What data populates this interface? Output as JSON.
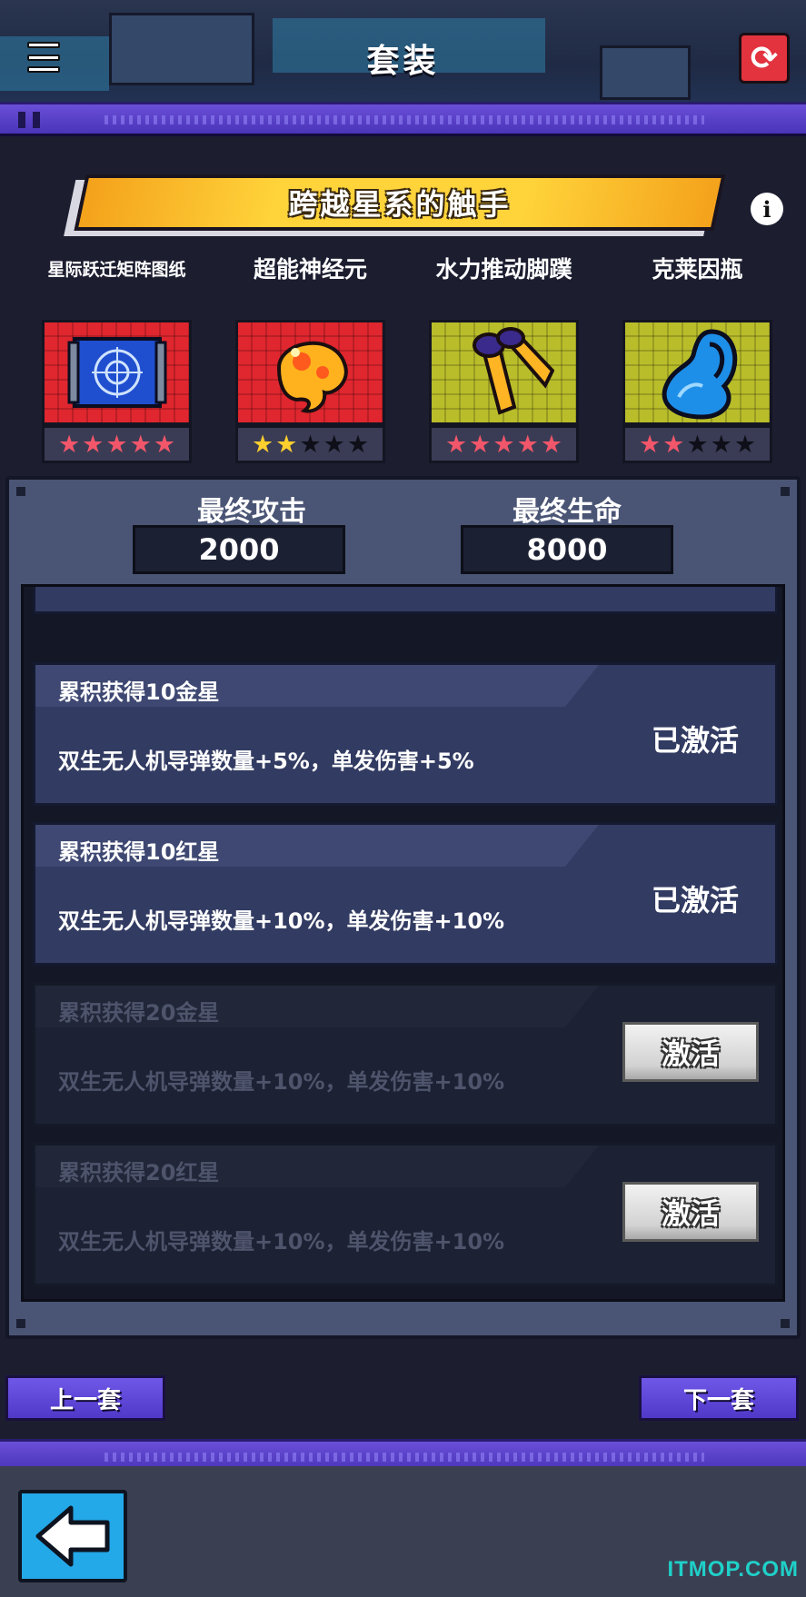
{
  "header": {
    "title": "套装",
    "menu_icon": "list-icon",
    "refresh_icon": "refresh-icon"
  },
  "set": {
    "name": "跨越星系的触手",
    "info_icon": "info-icon"
  },
  "items": [
    {
      "name": "星际跃迁矩阵图纸",
      "bg": "red",
      "rarity": "red",
      "stars_filled": 5,
      "stars_total": 5,
      "icon": "blueprint-icon"
    },
    {
      "name": "超能神经元",
      "bg": "red",
      "rarity": "gold",
      "stars_filled": 2,
      "stars_total": 5,
      "icon": "neuron-blob-icon"
    },
    {
      "name": "水力推动脚蹼",
      "bg": "yellow",
      "rarity": "red",
      "stars_filled": 5,
      "stars_total": 5,
      "icon": "flippers-icon"
    },
    {
      "name": "克莱因瓶",
      "bg": "yellow",
      "rarity": "red",
      "stars_filled": 2,
      "stars_total": 5,
      "icon": "klein-bottle-icon"
    }
  ],
  "stats": {
    "attack_label": "最终攻击",
    "attack_value": "2000",
    "life_label": "最终生命",
    "life_value": "8000"
  },
  "bonuses": [
    {
      "title": "累积获得10金星",
      "desc": "双生无人机导弹数量+5%，单发伤害+5%",
      "status": "已激活",
      "active": true
    },
    {
      "title": "累积获得10红星",
      "desc": "双生无人机导弹数量+10%，单发伤害+10%",
      "status": "已激活",
      "active": true
    },
    {
      "title": "累积获得20金星",
      "desc": "双生无人机导弹数量+10%，单发伤害+10%",
      "status": "激活",
      "active": false
    },
    {
      "title": "累积获得20红星",
      "desc": "双生无人机导弹数量+10%，单发伤害+10%",
      "status": "激活",
      "active": false
    }
  ],
  "nav": {
    "prev": "上一套",
    "next": "下一套",
    "back_icon": "back-arrow-icon"
  },
  "watermark": "ITMOP.COM",
  "colors": {
    "accent_purple": "#5a42d4",
    "banner_yellow": "#ffd33a",
    "card_red": "#e0262e",
    "card_yellow": "#b9bd2a",
    "back_blue": "#23a8e8"
  }
}
